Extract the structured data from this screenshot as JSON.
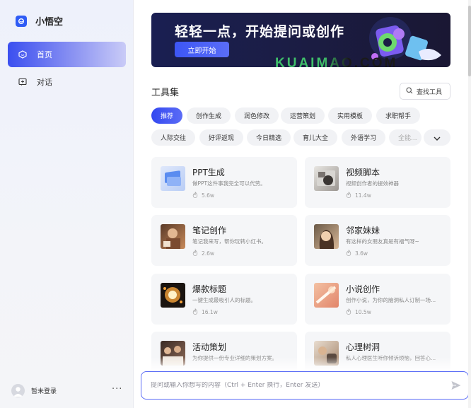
{
  "brand": {
    "name": "小悟空"
  },
  "nav": [
    {
      "label": "首页",
      "icon": "home-icon",
      "active": true
    },
    {
      "label": "对话",
      "icon": "chat-icon",
      "active": false
    }
  ],
  "user": {
    "name": "暂未登录",
    "more": "···"
  },
  "banner": {
    "title": "轻轻一点，开始提问或创作",
    "button": "立即开始",
    "watermark": "KUAIMAO.COM"
  },
  "tools": {
    "title": "工具集",
    "search_label": "查找工具",
    "categories_row1": [
      "推荐",
      "创作生成",
      "润色修改",
      "运营策划",
      "实用模板",
      "求职帮手"
    ],
    "categories_row2": [
      "人际交往",
      "好评返现",
      "今日精选",
      "育儿大全",
      "外语学习",
      "全能..."
    ],
    "active_category": "推荐"
  },
  "cards": [
    {
      "title": "PPT生成",
      "desc": "做PPT这件事我完全可以代劳。",
      "count": "5.6w",
      "thumb": "ppt-thumbnail"
    },
    {
      "title": "视频脚本",
      "desc": "视频创作者的提效神器",
      "count": "11.4w",
      "thumb": "video-script-thumbnail"
    },
    {
      "title": "笔记创作",
      "desc": "笔记我来写，帮你玩转小红书。",
      "count": "2.6w",
      "thumb": "notes-thumbnail"
    },
    {
      "title": "邻家妹妹",
      "desc": "有这样的女朋友真是有福气呀~",
      "count": "3.6w",
      "thumb": "girl-portrait-thumbnail"
    },
    {
      "title": "爆款标题",
      "desc": "一键生成最吸引人的标题。",
      "count": "16.1w",
      "thumb": "fireworks-thumbnail"
    },
    {
      "title": "小说创作",
      "desc": "创作小说，为你的脑洞私人订制一场...",
      "count": "10.5w",
      "thumb": "novel-thumbnail"
    },
    {
      "title": "活动策划",
      "desc": "为你提供一份专业详细的策划方案。",
      "count": "",
      "thumb": "event-thumbnail"
    },
    {
      "title": "心理树洞",
      "desc": "私人心理医生听你倾诉烦恼，回答心...",
      "count": "",
      "thumb": "psychology-thumbnail"
    }
  ],
  "input": {
    "placeholder": "提问或输入你想写的内容（Ctrl + Enter 换行，Enter 发送）"
  },
  "colors": {
    "accent": "#3b4ff0",
    "banner_bg": "#1a1f52",
    "card_bg": "#f5f6f8"
  }
}
